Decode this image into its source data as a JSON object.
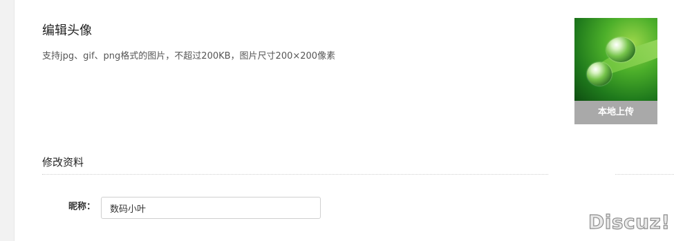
{
  "avatar_section": {
    "title": "编辑头像",
    "hint": "支持jpg、gif、png格式的图片，不超过200KB，图片尺寸200×200像素",
    "upload_label": "本地上传"
  },
  "profile_section": {
    "title": "修改资料",
    "nickname_label": "昵称：",
    "nickname_value": "数码小叶"
  },
  "watermark": "Discuz!",
  "colors": {
    "upload_button_bg": "#a9a9a9",
    "left_strip_bg": "#f2f2f2"
  }
}
